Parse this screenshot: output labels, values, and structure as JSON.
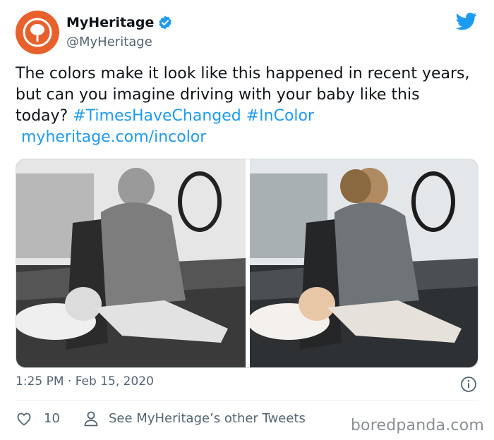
{
  "tweet": {
    "display_name": "MyHeritage",
    "handle": "@MyHeritage",
    "text_part1": "The colors make it look like this happened in recent years, but can you imagine driving with your baby like this today? ",
    "hashtag1": "#TimesHaveChanged",
    "hashtag2": "#InColor",
    "url": "myheritage.com/incolor",
    "timestamp": "1:25 PM · Feb 15, 2020",
    "like_count": "10",
    "see_more": "See MyHeritage’s other Tweets",
    "verified": true
  },
  "media": {
    "left_image": "black-and-white photo of woman driving car with baby lying on seat cushion",
    "right_image": "colorized photo of woman driving car with baby lying on seat cushion"
  },
  "icons": {
    "avatar": "myheritage-logo-icon",
    "verified": "verified-badge-icon",
    "bird": "twitter-bird-icon",
    "info": "info-icon",
    "like": "heart-icon",
    "profile": "person-icon"
  },
  "watermark": "boredpanda.com",
  "colors": {
    "brand_orange": "#e8612c",
    "link_blue": "#1d9bf0",
    "secondary_text": "#536471"
  }
}
